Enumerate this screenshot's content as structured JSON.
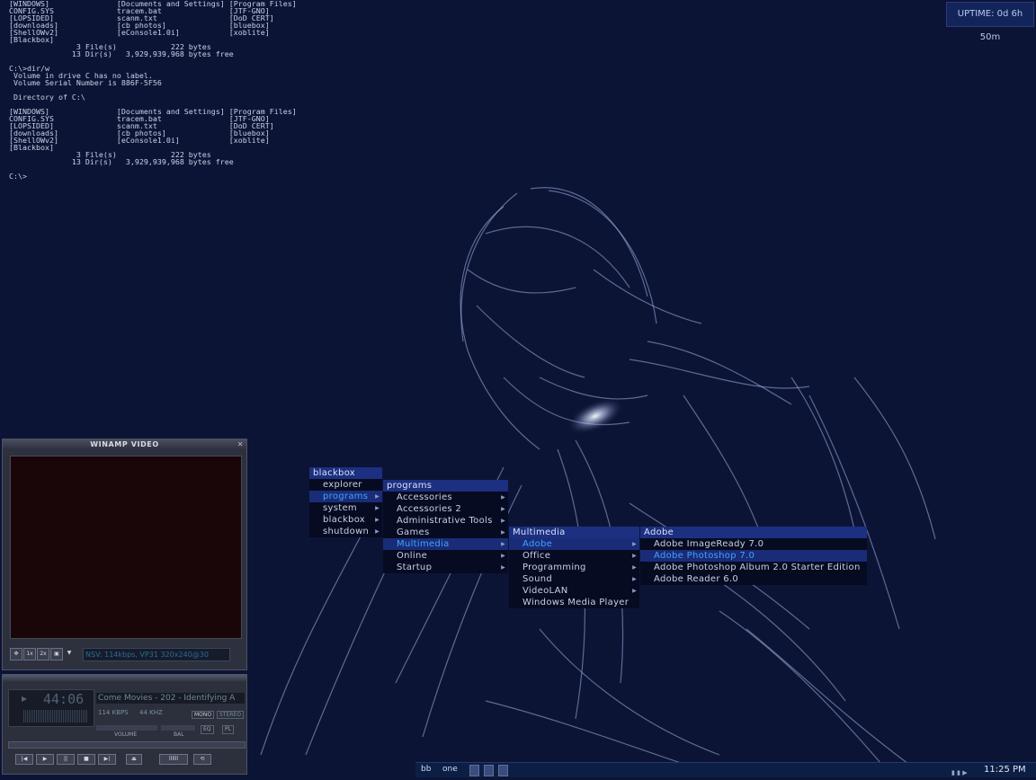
{
  "console": {
    "lines": [
      "[WINDOWS]               [Documents and Settings] [Program Files]",
      "CONFIG.SYS              tracem.bat               [JTF-GNO]",
      "[LOPSIDED]              scanm.txt                [DoD CERT]",
      "[downloads]             [cb photos]              [bluebox]",
      "[ShellOWv2]             [eConsole1.0i]           [xoblite]",
      "[Blackbox]",
      "               3 File(s)            222 bytes",
      "              13 Dir(s)   3,929,939,968 bytes free",
      "",
      "C:\\>dir/w",
      " Volume in drive C has no label.",
      " Volume Serial Number is 886F-5F56",
      "",
      " Directory of C:\\",
      "",
      "[WINDOWS]               [Documents and Settings] [Program Files]",
      "CONFIG.SYS              tracem.bat               [JTF-GNO]",
      "[LOPSIDED]              scanm.txt                [DoD CERT]",
      "[downloads]             [cb photos]              [bluebox]",
      "[ShellOWv2]             [eConsole1.0i]           [xoblite]",
      "[Blackbox]",
      "               3 File(s)            222 bytes",
      "              13 Dir(s)   3,929,939,968 bytes free",
      "",
      "C:\\>"
    ]
  },
  "uptime": {
    "label": "UPTIME: 0d 6h 50m"
  },
  "menus": {
    "blackbox": {
      "title": "blackbox",
      "items": [
        {
          "label": "explorer",
          "submenu": false
        },
        {
          "label": "programs",
          "submenu": true,
          "active": true
        },
        {
          "label": "system",
          "submenu": true
        },
        {
          "label": "blackbox",
          "submenu": true
        },
        {
          "label": "shutdown",
          "submenu": true
        }
      ]
    },
    "programs": {
      "title": "programs",
      "items": [
        {
          "label": "Accessories",
          "submenu": true
        },
        {
          "label": "Accessories 2",
          "submenu": true
        },
        {
          "label": "Administrative Tools",
          "submenu": true
        },
        {
          "label": "Games",
          "submenu": true
        },
        {
          "label": "Multimedia",
          "submenu": true,
          "active": true
        },
        {
          "label": "Online",
          "submenu": true
        },
        {
          "label": "Startup",
          "submenu": true
        }
      ]
    },
    "multimedia": {
      "title": "Multimedia",
      "items": [
        {
          "label": "Adobe",
          "submenu": true,
          "active": true
        },
        {
          "label": "Office",
          "submenu": true
        },
        {
          "label": "Programming",
          "submenu": true
        },
        {
          "label": "Sound",
          "submenu": true
        },
        {
          "label": "VideoLAN",
          "submenu": true
        },
        {
          "label": "Windows Media Player",
          "submenu": false
        }
      ]
    },
    "adobe": {
      "title": "Adobe",
      "items": [
        {
          "label": "Adobe ImageReady 7.0",
          "submenu": false
        },
        {
          "label": "Adobe Photoshop 7.0",
          "submenu": false,
          "active": true
        },
        {
          "label": "Adobe Photoshop Album 2.0 Starter Edition",
          "submenu": false
        },
        {
          "label": "Adobe Reader 6.0",
          "submenu": false
        }
      ]
    }
  },
  "winamp_video": {
    "title": "WINAMP VIDEO",
    "close": "✕",
    "buttons": [
      "✥",
      "1x",
      "2x",
      "▣",
      "▼"
    ],
    "info": "NSV: 114kbps, VP31 320x240@30"
  },
  "winamp_main": {
    "time": "44:06",
    "play_indicator": "▶",
    "song": "Come Movies - 202 - Identifying A",
    "kbps": "114",
    "kbps_unit": "KBPS",
    "khz": "44",
    "khz_unit": "KHZ",
    "mono": "MONO",
    "stereo": "STEREO",
    "volume_label": "VOLUME",
    "bal_label": "BAL",
    "eq": "EQ",
    "pl": "PL",
    "transport": [
      "|◀",
      "▶",
      "||",
      "■",
      "▶|"
    ],
    "eject": "⏏",
    "shuffle": "llllll",
    "repeat": "⟲"
  },
  "taskbar": {
    "workspaces": [
      "bb",
      "one"
    ],
    "clock": "11:25 PM",
    "tray_icons": [
      "▮",
      "▮",
      "▶"
    ]
  },
  "colors": {
    "background": "#0c1436",
    "menu_title": "#1c2f80",
    "menu_highlight": "#3fa2ff"
  }
}
